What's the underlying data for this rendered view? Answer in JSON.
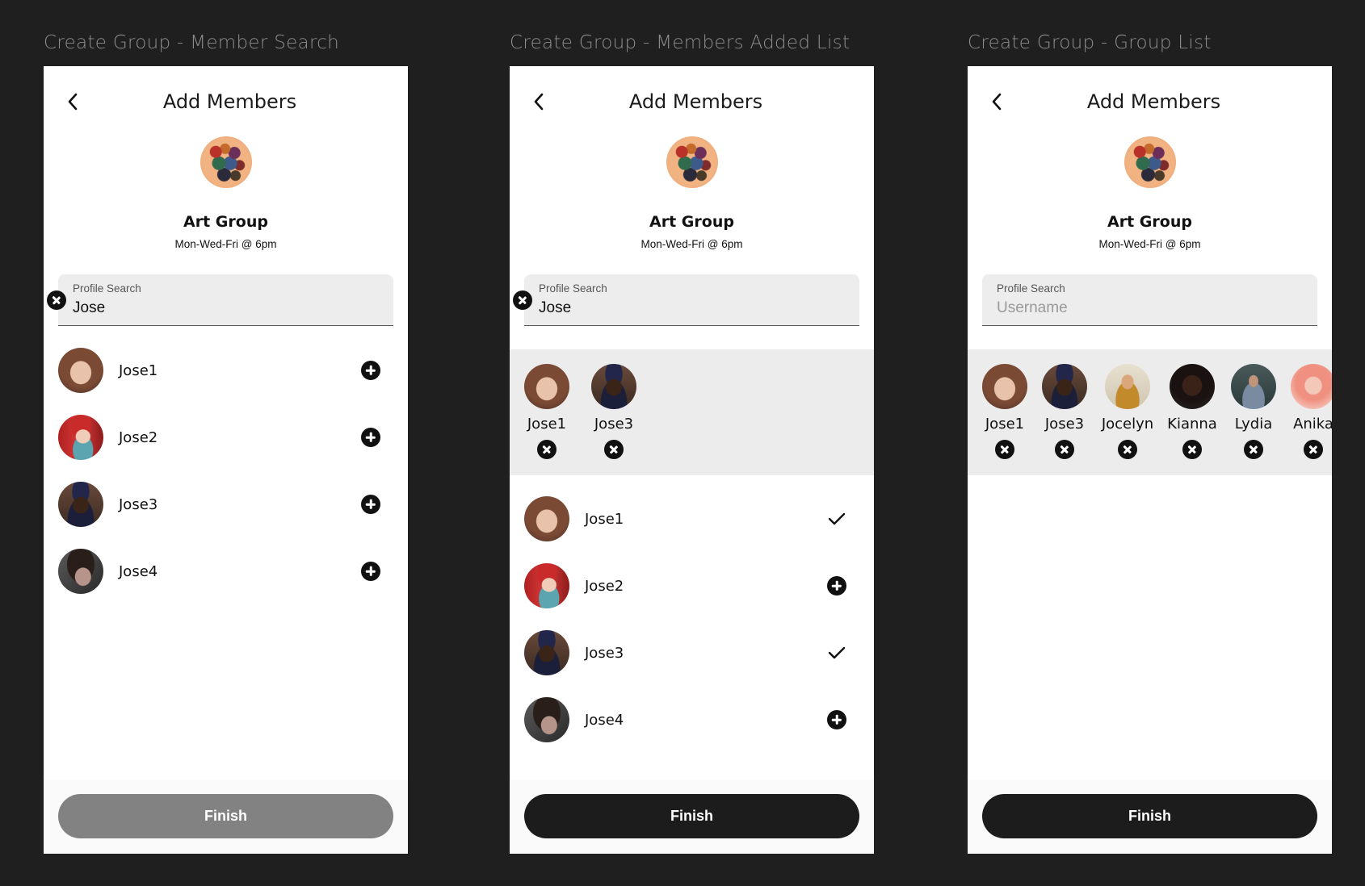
{
  "frames": [
    {
      "label": "Create Group - Member Search"
    },
    {
      "label": "Create Group - Members Added List"
    },
    {
      "label": "Create Group - Group List"
    }
  ],
  "header": {
    "title": "Add Members"
  },
  "group": {
    "name": "Art Group",
    "schedule": "Mon-Wed-Fri @ 6pm"
  },
  "search": {
    "label": "Profile Search",
    "value": "Jose",
    "placeholder": "Username"
  },
  "members": [
    {
      "name": "Jose1",
      "avatar": "woman-portrait"
    },
    {
      "name": "Jose2",
      "avatar": "woman-red-hat-portrait"
    },
    {
      "name": "Jose3",
      "avatar": "man-beret-portrait"
    },
    {
      "name": "Jose4",
      "avatar": "man-hair-over-face-portrait"
    }
  ],
  "screen2": {
    "selected": [
      {
        "name": "Jose1"
      },
      {
        "name": "Jose3"
      }
    ],
    "row_states": [
      "added",
      "add",
      "added",
      "add"
    ]
  },
  "screen3": {
    "selected": [
      {
        "name": "Jose1"
      },
      {
        "name": "Jose3"
      },
      {
        "name": "Jocelyn"
      },
      {
        "name": "Kianna"
      },
      {
        "name": "Lydia"
      },
      {
        "name": "Anika"
      }
    ]
  },
  "finish": {
    "label": "Finish"
  },
  "colors": {
    "background": "#1f1f1f",
    "finish_disabled": "#828282",
    "finish_enabled": "#1c1c1c",
    "selected_strip": "#ececec"
  }
}
